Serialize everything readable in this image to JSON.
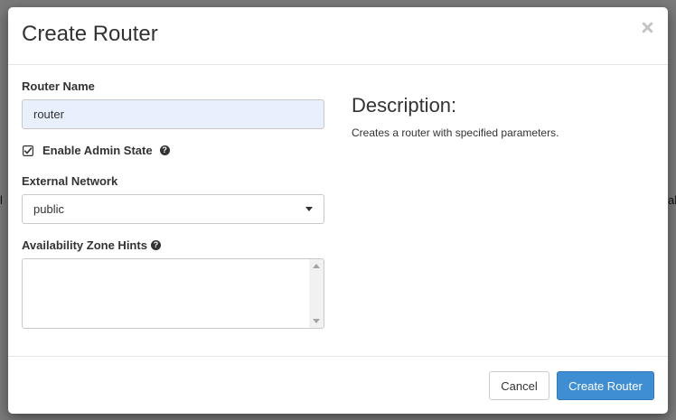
{
  "backdrop": {
    "left_fragment": "l",
    "right_fragment": "al"
  },
  "modal": {
    "title": "Create Router",
    "close_glyph": "×"
  },
  "form": {
    "router_name": {
      "label": "Router Name",
      "value": "router"
    },
    "admin_state": {
      "label": "Enable Admin State",
      "checked": true,
      "help_glyph": "?"
    },
    "external_network": {
      "label": "External Network",
      "selected": "public"
    },
    "availability_zone_hints": {
      "label": "Availability Zone Hints",
      "help_glyph": "?",
      "value": ""
    }
  },
  "description": {
    "title": "Description:",
    "text": "Creates a router with specified parameters."
  },
  "footer": {
    "cancel_label": "Cancel",
    "submit_label": "Create Router"
  },
  "colors": {
    "primary": "#3f8ed4",
    "input_autofill": "#e8f0fe"
  }
}
